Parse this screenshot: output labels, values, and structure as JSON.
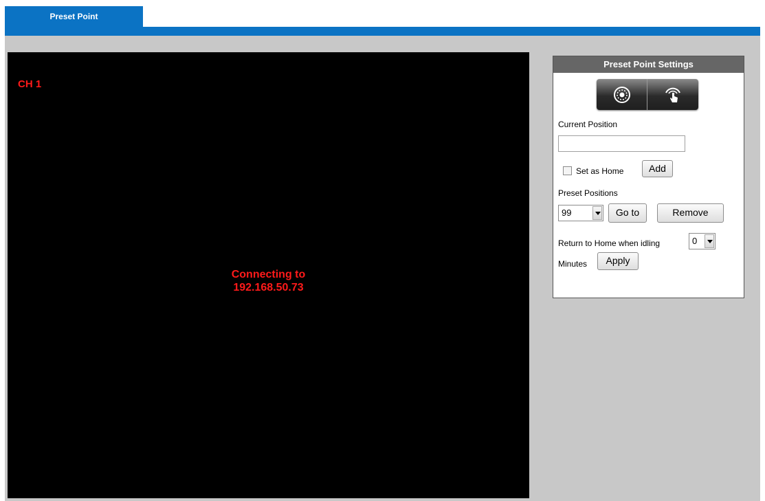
{
  "tabs": [
    {
      "label": "Preset Point",
      "active": true
    }
  ],
  "video": {
    "channel_label": "CH 1",
    "status_line1": "Connecting to",
    "status_line2": "192.168.50.73"
  },
  "panel": {
    "title": "Preset Point Settings",
    "ptz_buttons": [
      {
        "icon": "dial-icon"
      },
      {
        "icon": "hand-pointer-icon"
      }
    ],
    "current_position_label": "Current Position",
    "current_position_value": "",
    "set_as_home_label": "Set as Home",
    "set_as_home_checked": false,
    "add_label": "Add",
    "preset_positions_label": "Preset Positions",
    "preset_selected": "99",
    "goto_label": "Go to",
    "remove_label": "Remove",
    "return_home_label": "Return to Home when idling",
    "idle_minutes_selected": "0",
    "minutes_label": "Minutes",
    "apply_label": "Apply"
  },
  "colors": {
    "tab_blue": "#0b73c4",
    "overlay_red": "#ff1a1a",
    "background_gray": "#c8c8c8",
    "panel_header": "#666666"
  }
}
